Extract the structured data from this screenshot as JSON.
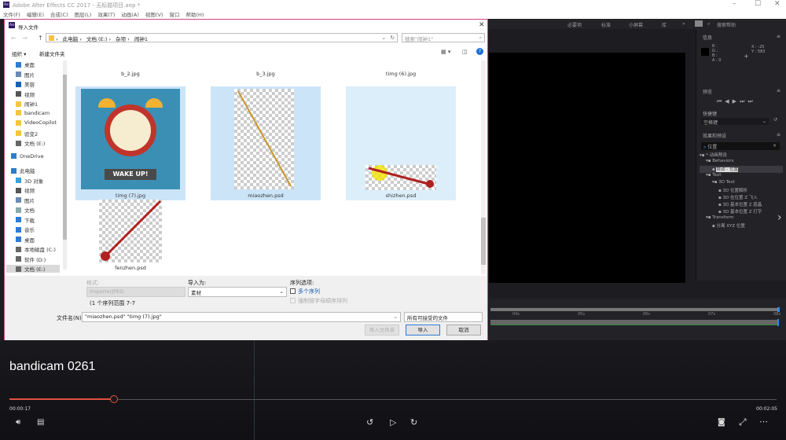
{
  "app": {
    "title": "Adobe After Effects CC 2017 - 无标题项目.aep *",
    "menu": [
      "文件(F)",
      "编辑(E)",
      "合成(C)",
      "图层(L)",
      "效果(T)",
      "动画(A)",
      "视图(V)",
      "窗口",
      "帮助(H)"
    ],
    "workspaces": [
      "必要项",
      "标准",
      "小屏幕",
      "库"
    ],
    "more": "»",
    "search_placeholder": "搜索帮助"
  },
  "info_panel": {
    "title": "信息",
    "r": "R :",
    "g": "G :",
    "b": "B :",
    "a": "A : 0",
    "x": "X : -25",
    "y": "Y : 583"
  },
  "preview_panel": {
    "title": "预览",
    "shortcut_label": "快捷键",
    "shortcut_value": "空格键"
  },
  "effects_panel": {
    "title": "效果和预设",
    "search": "位置",
    "tree": [
      {
        "label": "* 动画预设",
        "level": 0
      },
      {
        "label": "Behaviors",
        "level": 1
      },
      {
        "label": "自动 - 位置",
        "level": 2,
        "selected": true
      },
      {
        "label": "Text",
        "level": 1
      },
      {
        "label": "3D Text",
        "level": 2
      },
      {
        "label": "3D 位置解析",
        "level": 3
      },
      {
        "label": "3D 在位置 Z 飞入",
        "level": 3
      },
      {
        "label": "3D 基本位置 Z 层晶",
        "level": 3
      },
      {
        "label": "3D 基本位置 Z 打字",
        "level": 3
      },
      {
        "label": "Transform",
        "level": 1
      },
      {
        "label": "分离 XYZ 位置",
        "level": 2
      }
    ]
  },
  "timeline": {
    "ticks": [
      "04s",
      "05s",
      "06s",
      "07s",
      "08s"
    ]
  },
  "dialog": {
    "title": "导入文件",
    "breadcrumb": [
      "此电脑",
      "文档 (E:)",
      "杂项",
      "闹钟1"
    ],
    "search_placeholder": "搜索\"闹钟1\"",
    "toolbar": {
      "organize": "组织 ▾",
      "new_folder": "新建文件夹"
    },
    "sidebar": [
      {
        "label": "桌面",
        "icon": "desktop"
      },
      {
        "label": "图片",
        "icon": "pictures"
      },
      {
        "label": "美容",
        "icon": "app"
      },
      {
        "label": "视频",
        "icon": "video"
      },
      {
        "label": "闹钟1",
        "icon": "folder"
      },
      {
        "label": "bandicam",
        "icon": "folder"
      },
      {
        "label": "VideoCopilot",
        "icon": "folder"
      },
      {
        "label": "验变2",
        "icon": "folder"
      },
      {
        "label": "文档 (E:)",
        "icon": "drive"
      },
      {
        "label": "OneDrive",
        "icon": "cloud"
      },
      {
        "label": "此电脑",
        "icon": "computer"
      },
      {
        "label": "3D 对象",
        "icon": "3d"
      },
      {
        "label": "视频",
        "icon": "video"
      },
      {
        "label": "图片",
        "icon": "pictures"
      },
      {
        "label": "文档",
        "icon": "document"
      },
      {
        "label": "下载",
        "icon": "download"
      },
      {
        "label": "音乐",
        "icon": "music"
      },
      {
        "label": "桌面",
        "icon": "desktop"
      },
      {
        "label": "本地磁盘 (C:)",
        "icon": "drive"
      },
      {
        "label": "软件 (D:)",
        "icon": "drive"
      },
      {
        "label": "文档 (E:)",
        "icon": "drive",
        "selected": true
      }
    ],
    "files": [
      {
        "name": "b_2.jpg"
      },
      {
        "name": "b_3.jpg"
      },
      {
        "name": "timg (6).jpg"
      },
      {
        "name": "timg (7).jpg",
        "selected": true,
        "caption": "WAKE UP!"
      },
      {
        "name": "miaozhen.psd",
        "selected": true
      },
      {
        "name": "shizhen.psd",
        "selected": true
      },
      {
        "name": "fenzhen.psd"
      }
    ],
    "format_label": "格式:",
    "format_value": "ImporterJPEG",
    "import_as_label": "导入为:",
    "import_as_value": "素材",
    "sequence_label": "序列选项:",
    "multi_seq": "多个序列",
    "force_alpha": "强制按字母顺序排列",
    "seq_range": "(1 个序列范围 7-7",
    "filename_label": "文件名(N):",
    "filename_value": "\"miaozhen.psd\" \"timg (7).jpg\"",
    "filetype": "所有可接受的文件 (*.prproj;*.a",
    "import_folder": "导入文件夹",
    "import": "导入",
    "cancel": "取消"
  },
  "player": {
    "title": "bandicam 0261",
    "current": "00:00:17",
    "total": "00:02:05",
    "progress": 0.136,
    "accent": "#e0523f"
  }
}
